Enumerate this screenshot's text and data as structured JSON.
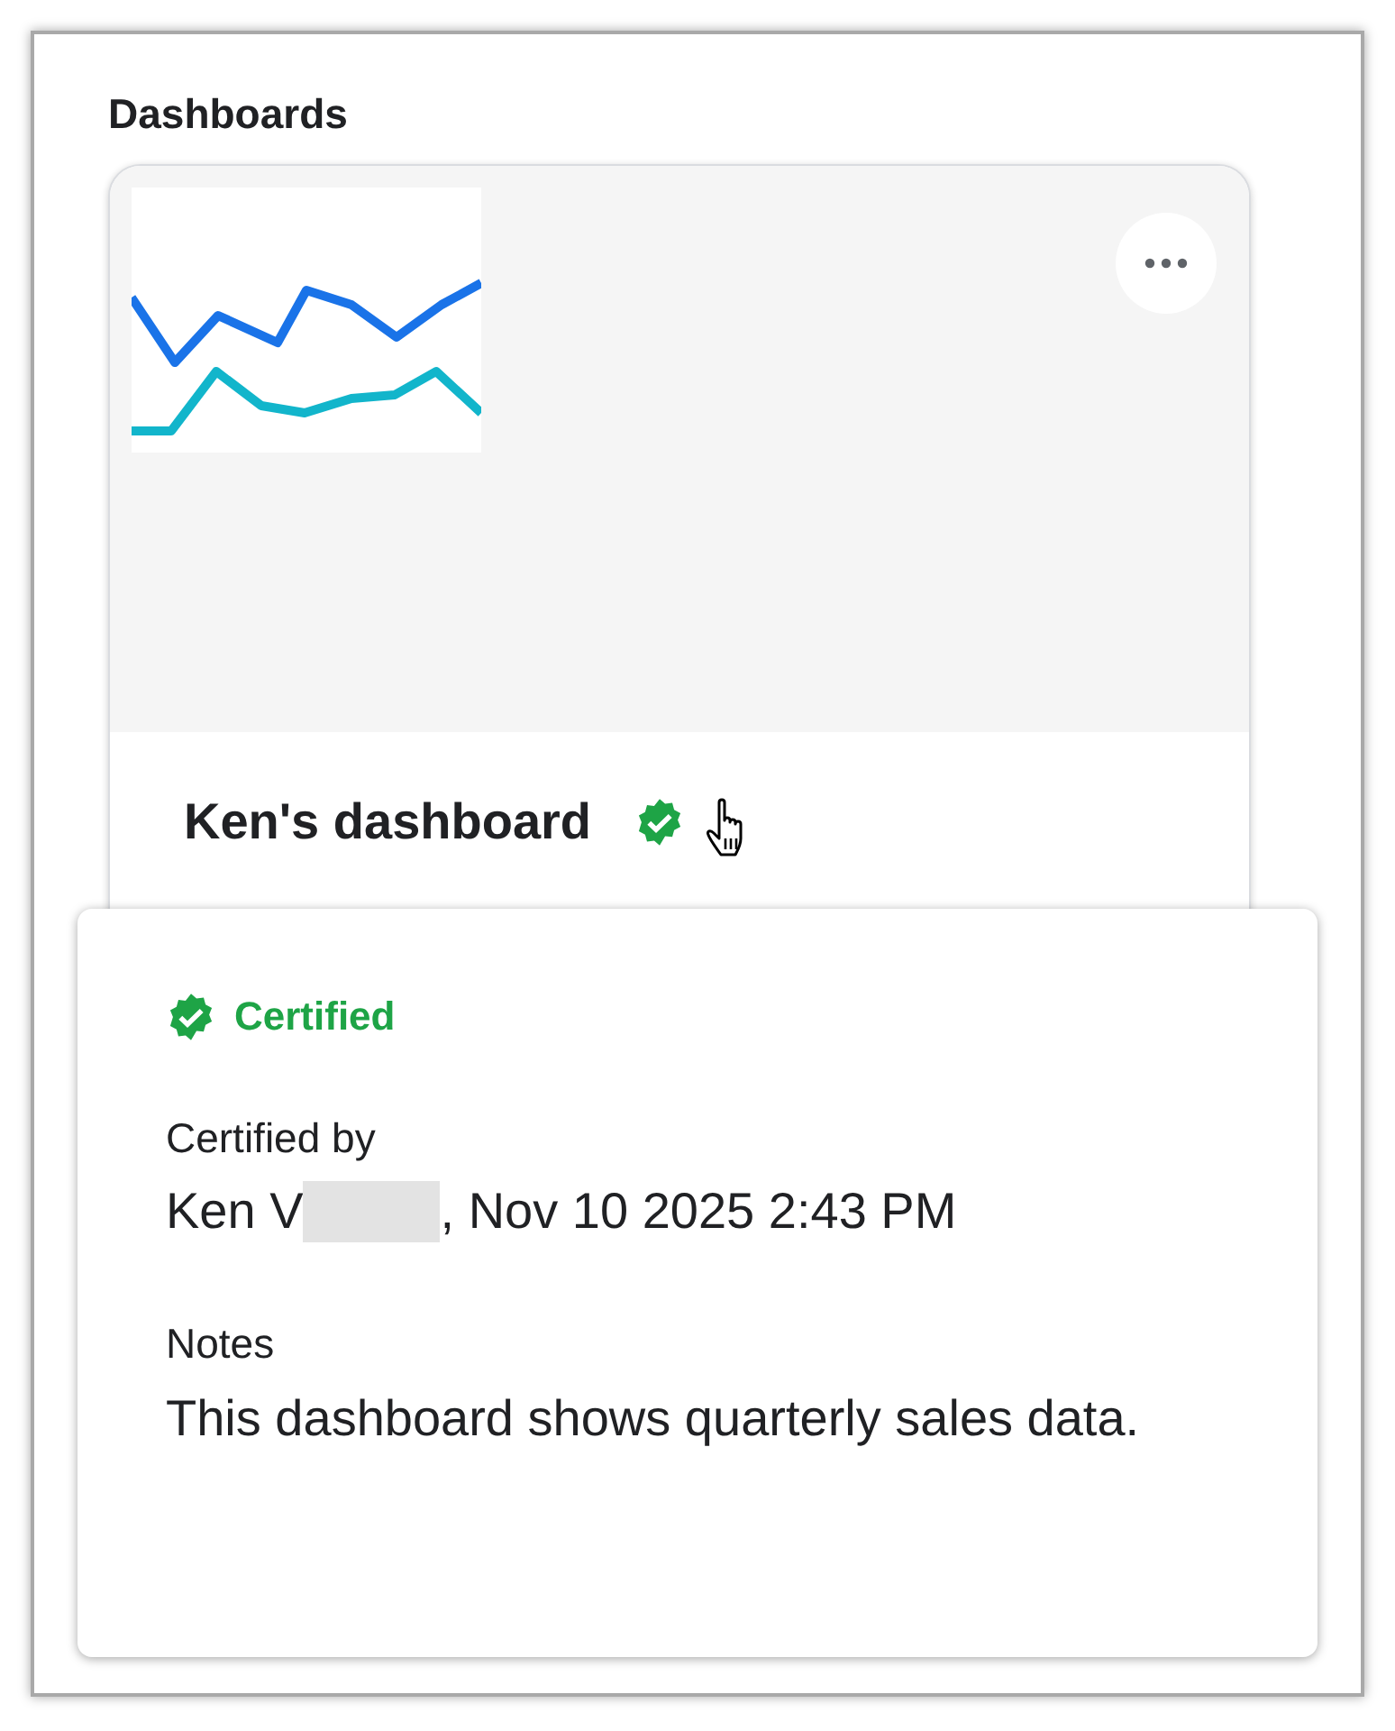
{
  "heading": "Dashboards",
  "card": {
    "title": "Ken's dashboard",
    "certified": true
  },
  "popover": {
    "status": "Certified",
    "certified_by_label": "Certified by",
    "certifier": "Ken V",
    "certified_at": ", Nov 10 2025 2:43 PM",
    "notes_label": "Notes",
    "notes": "This dashboard shows quarterly sales data."
  }
}
